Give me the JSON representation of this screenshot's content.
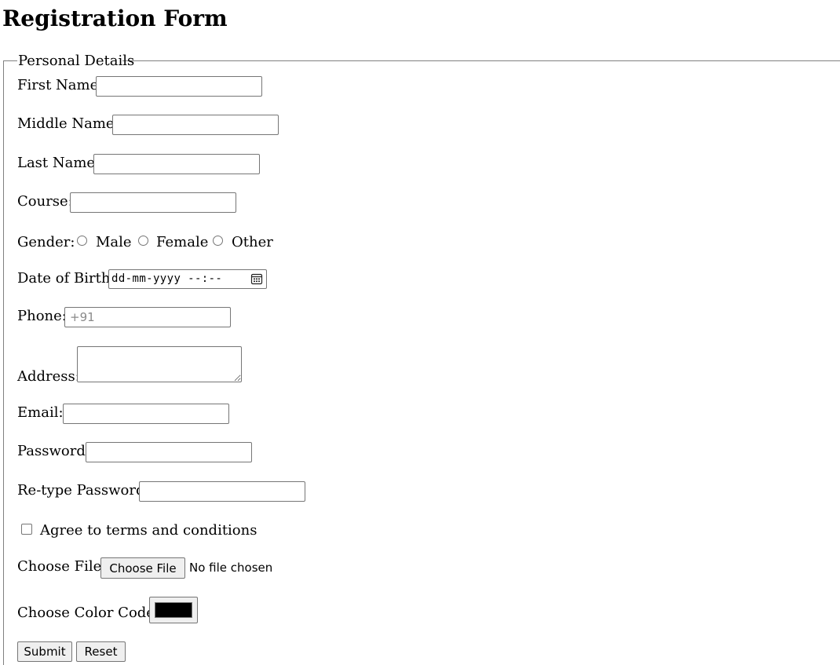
{
  "page": {
    "title": "Registration Form"
  },
  "fieldset": {
    "legend": "Personal Details"
  },
  "fields": {
    "first_name": {
      "label": "First Name:",
      "value": ""
    },
    "middle_name": {
      "label": "Middle Name:",
      "value": ""
    },
    "last_name": {
      "label": "Last Name:",
      "value": ""
    },
    "course": {
      "label": "Course:",
      "value": ""
    },
    "gender": {
      "label": "Gender:",
      "options": [
        "Male",
        "Female",
        "Other"
      ],
      "selected": ""
    },
    "dob": {
      "label": "Date of Birth:",
      "placeholder": "dd-mm-yyyy --:--"
    },
    "phone": {
      "label": "Phone:",
      "placeholder": "+91",
      "value": ""
    },
    "address": {
      "label": "Address:",
      "value": ""
    },
    "email": {
      "label": "Email:",
      "value": ""
    },
    "password": {
      "label": "Password:",
      "value": ""
    },
    "retype_password": {
      "label": "Re-type Password:",
      "value": ""
    },
    "terms": {
      "label": "Agree to terms and conditions",
      "checked": false
    },
    "file": {
      "label": "Choose File:",
      "button": "Choose File",
      "status": "No file chosen"
    },
    "color": {
      "label": "Choose Color Code:",
      "value": "#000000"
    }
  },
  "buttons": {
    "submit": "Submit",
    "reset": "Reset"
  },
  "icons": {
    "calendar": "calendar-icon"
  },
  "colors": {
    "border": "#767676",
    "button_bg": "#efefef",
    "fieldset_border": "#808080"
  }
}
